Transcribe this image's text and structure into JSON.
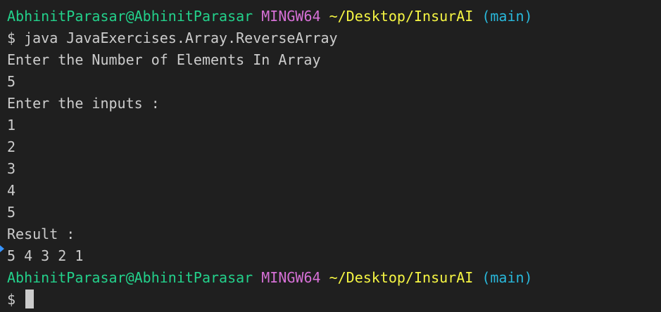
{
  "terminal": {
    "prompt": {
      "user": "AbhinitParasar@AbhinitParasar",
      "env": "MINGW64",
      "path": "~/Desktop/InsurAI",
      "branch": "(main)"
    },
    "command_line": "$ java JavaExercises.Array.ReverseArray",
    "output": [
      "Enter the Number of Elements In Array",
      "5",
      "Enter the inputs :",
      "1",
      "2",
      "3",
      "4",
      "5",
      "Result :",
      "5 4 3 2 1"
    ],
    "final_prompt_symbol": "$"
  },
  "colors": {
    "background": "#1f1f1f",
    "text": "#cccccc",
    "user": "#23d18b",
    "env": "#d670d6",
    "path": "#f5f543",
    "branch": "#29b8db"
  },
  "icons": {
    "gutter_marker": "command-decoration-icon"
  }
}
